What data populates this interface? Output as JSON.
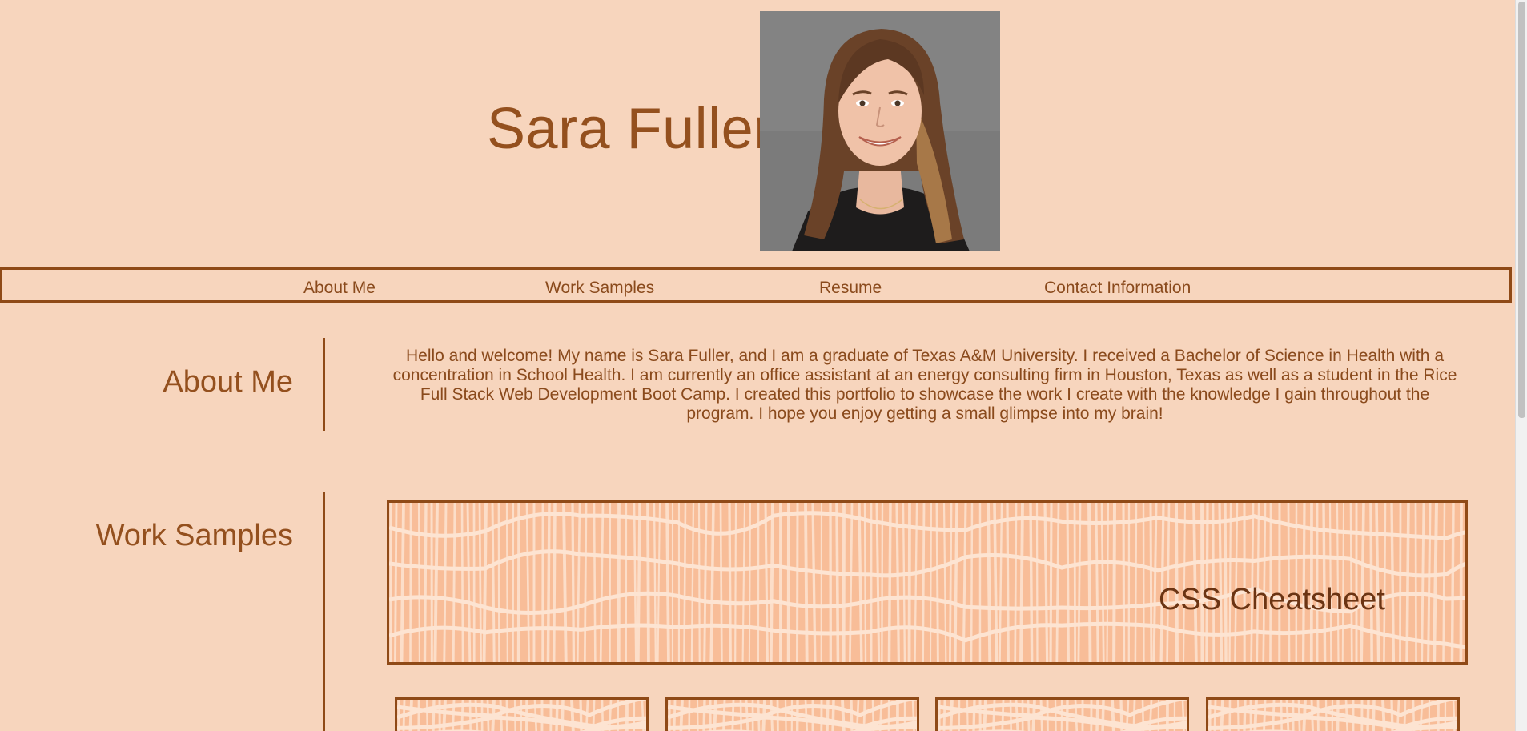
{
  "header": {
    "title": "Sara Fuller",
    "portrait_alt": "Headshot photo of Sara Fuller"
  },
  "nav": {
    "items": [
      {
        "label": "About Me"
      },
      {
        "label": "Work Samples"
      },
      {
        "label": "Resume"
      },
      {
        "label": "Contact Information"
      }
    ]
  },
  "about": {
    "heading": "About Me",
    "text": "Hello and welcome! My name is Sara Fuller, and I am a graduate of Texas A&M University. I received a Bachelor of Science in Health with a concentration in School Health. I am currently an office assistant at an energy consulting firm in Houston, Texas as well as a student in the Rice Full Stack Web Development Boot Camp. I created this portfolio to showcase the work I create with the knowledge I gain throughout the program. I hope you enjoy getting a small glimpse into my brain!"
  },
  "work": {
    "heading": "Work Samples",
    "featured": {
      "title": "CSS Cheatsheet"
    },
    "cards": [
      {},
      {},
      {},
      {}
    ]
  },
  "colors": {
    "background": "#f7d5bd",
    "accent": "#8f4a17",
    "text": "#8a4a1c",
    "pattern_base": "#f8bd98",
    "pattern_light": "#fde4d2"
  }
}
